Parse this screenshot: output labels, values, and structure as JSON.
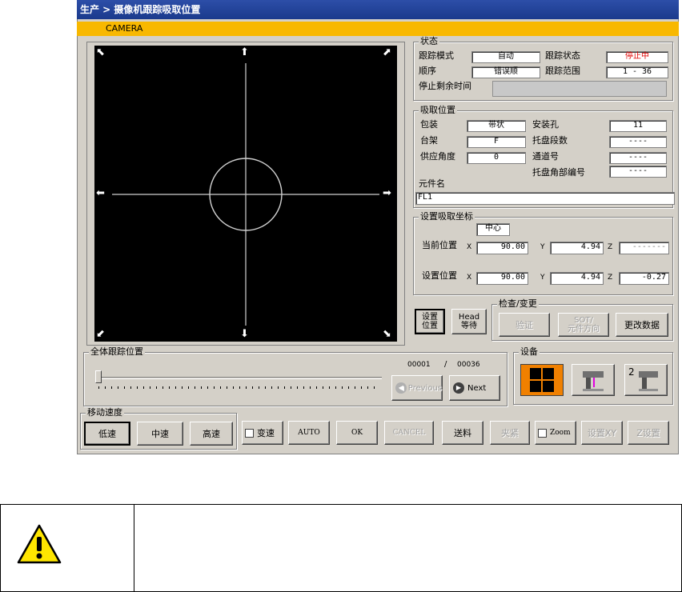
{
  "title": "生产 > 摄像机跟踪吸取位置",
  "camera_label": "CAMERA",
  "status": {
    "legend": "状态",
    "track_mode_label": "跟踪模式",
    "track_mode_value": "自动",
    "track_state_label": "跟踪状态",
    "track_state_value": "停止中",
    "order_label": "顺序",
    "order_value": "错误顺",
    "track_range_label": "跟踪范围",
    "track_range_value": "1 - 36",
    "stop_remaining_label": "停止剩余时间",
    "stop_remaining_value": ""
  },
  "pick": {
    "legend": "吸取位置",
    "package_label": "包装",
    "package_value": "带状",
    "mount_hole_label": "安装孔",
    "mount_hole_value": "11",
    "rack_label": "台架",
    "rack_value": "F",
    "tray_steps_label": "托盘段数",
    "tray_steps_value": "----",
    "feed_angle_label": "供应角度",
    "feed_angle_value": "0",
    "lane_label": "通道号",
    "lane_value": "----",
    "tray_corner_label": "托盘角部编号",
    "tray_corner_value": "----",
    "part_name_label": "元件名",
    "part_name_value": "FL1"
  },
  "coords": {
    "legend": "设置吸取坐标",
    "center": "中心",
    "current_label": "当前位置",
    "set_label": "设置位置",
    "x": "X",
    "y": "Y",
    "z": "Z",
    "current_x": "90.00",
    "current_y": "4.94",
    "current_z": "-------",
    "set_x": "90.00",
    "set_y": "4.94",
    "set_z": "-0.27"
  },
  "buttons": {
    "set_pos_1": "设置",
    "set_pos_2": "位置",
    "head_wait_1": "Head",
    "head_wait_2": "等待",
    "check_legend": "检查/变更",
    "verify": "验证",
    "sot_1": "SOT/",
    "sot_2": "元件方向",
    "change_data": "更改数据"
  },
  "track_all": {
    "legend": "全体跟踪位置",
    "current": "00001",
    "sep": "/",
    "total": "00036",
    "previous": "Previous",
    "next": "Next",
    "progress": 0.0
  },
  "device": {
    "legend": "设备",
    "badge": "2"
  },
  "speed": {
    "legend": "移动速度",
    "low": "低速",
    "mid": "中速",
    "high": "高速"
  },
  "toolbar": {
    "shift": "变速",
    "auto": "AUTO",
    "ok": "OK",
    "cancel": "CANCEL",
    "feed": "送料",
    "clamp": "夹紧",
    "zoom": "Zoom",
    "set_xy": "设置XY",
    "z_set": "Z设置"
  },
  "colors": {
    "title_bg": "#1a3a8c",
    "camera_bar": "#f8b800",
    "stop_red": "#e00000",
    "device_orange": "#f08000"
  }
}
